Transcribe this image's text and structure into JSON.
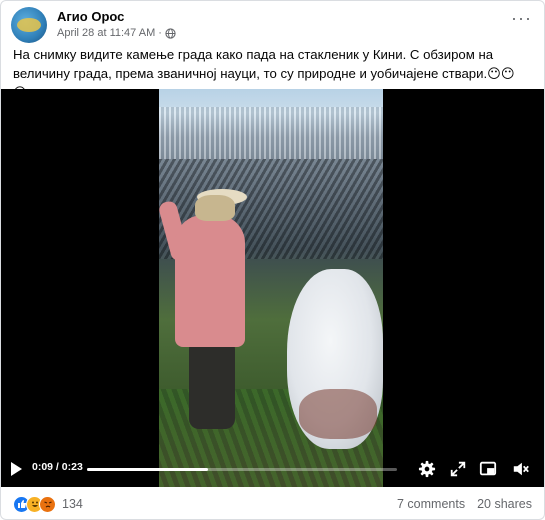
{
  "post": {
    "page_name": "Агио Орос",
    "date": "April 28 at 11:47 AM",
    "dot": "·",
    "text": "На снимку видите камење града како пада на стакленик у Кини. С обзиром на величину града, према званичној науци, то су природне и уобичајене ствари.😶😶😮",
    "more_label": "···"
  },
  "video": {
    "current_time": "0:09",
    "separator": " / ",
    "duration": "0:23",
    "progress": 0.39,
    "icons": [
      "play-icon",
      "settings-gear-icon",
      "fullscreen-expand-icon",
      "picture-in-picture-icon",
      "mute-speaker-icon"
    ]
  },
  "footer": {
    "reaction_icons": [
      "like-reaction-icon",
      "haha-reaction-icon",
      "angry-reaction-icon"
    ],
    "reaction_count": "134",
    "comments": "7 comments",
    "shares": "20 shares"
  },
  "colors": {
    "accent": "#1877f2",
    "secondary_text": "#65676b",
    "video_bg": "#000000"
  }
}
